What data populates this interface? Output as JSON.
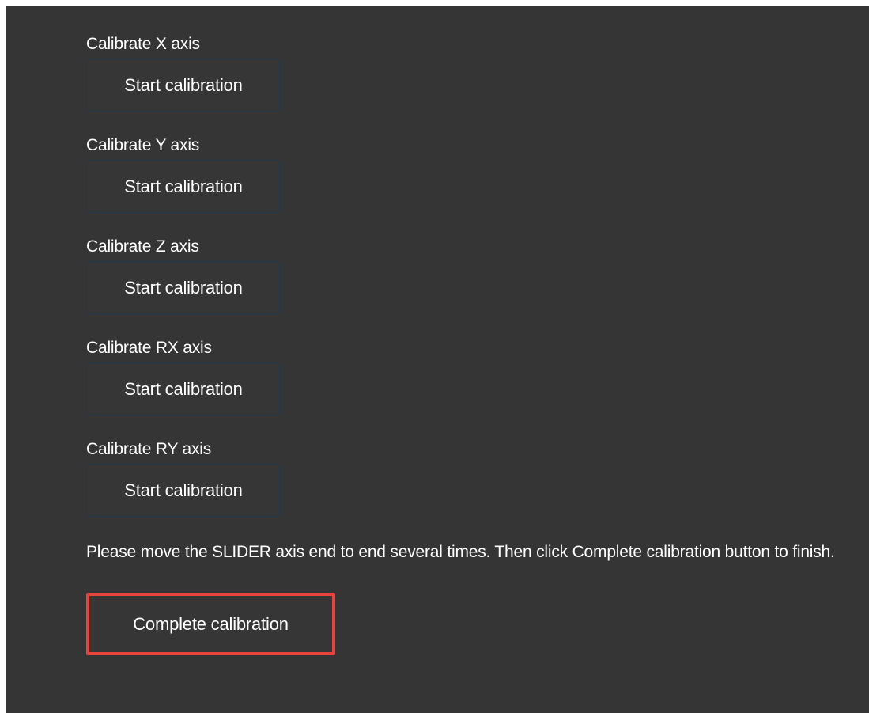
{
  "axes": [
    {
      "label": "Calibrate X axis",
      "button_label": "Start calibration"
    },
    {
      "label": "Calibrate Y axis",
      "button_label": "Start calibration"
    },
    {
      "label": "Calibrate Z axis",
      "button_label": "Start calibration"
    },
    {
      "label": "Calibrate RX axis",
      "button_label": "Start calibration"
    },
    {
      "label": "Calibrate RY axis",
      "button_label": "Start calibration"
    }
  ],
  "instructions": "Please move the SLIDER axis end to end several times. Then click Complete calibration button to finish.",
  "complete_button_label": "Complete calibration",
  "colors": {
    "background": "#353535",
    "button_border": "#20384e",
    "highlight": "#e8433c"
  }
}
